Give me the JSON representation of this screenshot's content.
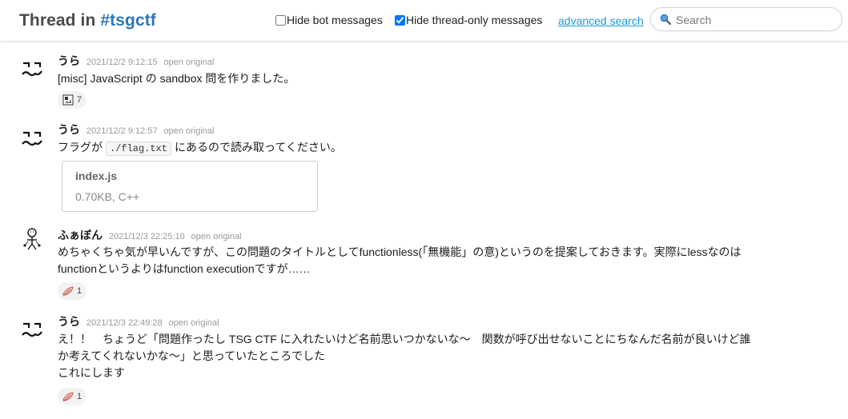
{
  "header": {
    "title_prefix": "Thread in ",
    "channel": "#tsgctf",
    "hide_bot_label": "Hide bot messages",
    "hide_bot_checked": false,
    "hide_thread_label": "Hide thread-only messages",
    "hide_thread_checked": true,
    "advanced_search": "advanced search",
    "search_placeholder": "Search"
  },
  "colors": {
    "channel": "#2e77b5",
    "link": "#1c9ad6",
    "timestamp": "#9a9a9a"
  },
  "messages": [
    {
      "author": "うら",
      "timestamp": "2021/12/2 9:12:15",
      "open_original": "open original",
      "text": "[misc] JavaScript の sandbox 問を作りました。",
      "reaction": {
        "icon": "broken-image-icon",
        "count": "7"
      }
    },
    {
      "author": "うら",
      "timestamp": "2021/12/2 9:12:57",
      "open_original": "open original",
      "text_before": "フラグが",
      "code": "./flag.txt",
      "text_after": "にあるので読み取ってください。",
      "file": {
        "name": "index.js",
        "meta": "0.70KB, C++"
      }
    },
    {
      "author": "ふぁぼん",
      "timestamp": "2021/12/3 22:25:10",
      "open_original": "open original",
      "text_line1": "めちゃくちゃ気が早いんですが、この問題のタイトルとしてfunctionless(「無機能」の意)というのを提案しておきます。実際にlessなのは",
      "text_line2": "functionというよりはfunction executionですが……",
      "reaction": {
        "icon": "feather-icon",
        "count": "1"
      }
    },
    {
      "author": "うら",
      "timestamp": "2021/12/3 22:49:28",
      "open_original": "open original",
      "text_line1": "え！！　ちょうど「問題作ったし TSG CTF に入れたいけど名前思いつかないな〜　関数が呼び出せないことにちなんだ名前が良いけど誰",
      "text_line2": "か考えてくれないかな〜」と思っていたところでした",
      "text_line3": "これにします",
      "reaction": {
        "icon": "feather-icon",
        "count": "1"
      }
    }
  ]
}
